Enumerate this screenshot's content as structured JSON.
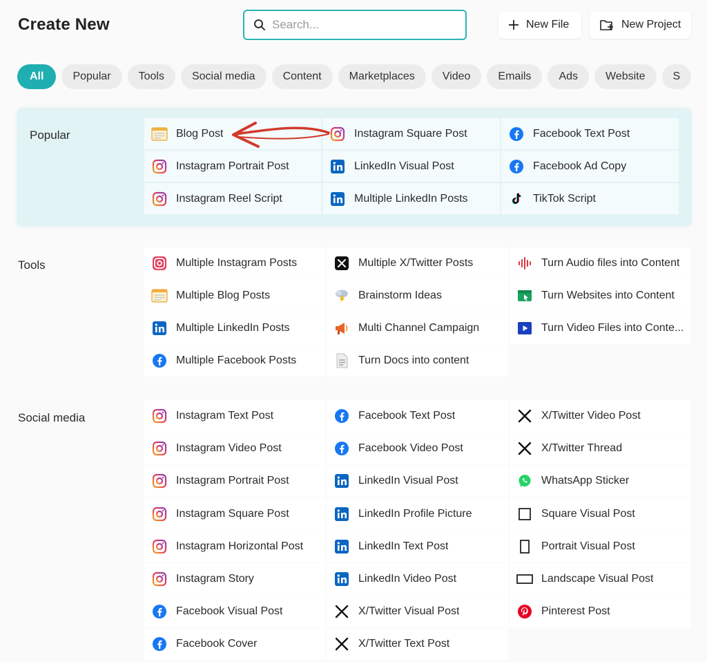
{
  "header": {
    "title": "Create New",
    "search_placeholder": "Search...",
    "new_file_label": "New File",
    "new_project_label": "New Project"
  },
  "filters": [
    "All",
    "Popular",
    "Tools",
    "Social media",
    "Content",
    "Marketplaces",
    "Video",
    "Emails",
    "Ads",
    "Website",
    "S"
  ],
  "sections": {
    "popular": {
      "label": "Popular",
      "items": [
        {
          "label": "Blog Post",
          "icon": "blog-icon"
        },
        {
          "label": "Instagram Square Post",
          "icon": "instagram-icon"
        },
        {
          "label": "Facebook Text Post",
          "icon": "facebook-icon"
        },
        {
          "label": "Instagram Portrait Post",
          "icon": "instagram-icon"
        },
        {
          "label": "LinkedIn Visual Post",
          "icon": "linkedin-icon"
        },
        {
          "label": "Facebook Ad Copy",
          "icon": "facebook-icon"
        },
        {
          "label": "Instagram Reel Script",
          "icon": "instagram-icon"
        },
        {
          "label": "Multiple LinkedIn Posts",
          "icon": "linkedin-icon"
        },
        {
          "label": "TikTok Script",
          "icon": "tiktok-icon"
        }
      ]
    },
    "tools": {
      "label": "Tools",
      "items": [
        {
          "label": "Multiple Instagram Posts",
          "icon": "instagram-multi-icon"
        },
        {
          "label": "Multiple X/Twitter Posts",
          "icon": "x-twitter-multi-icon"
        },
        {
          "label": "Turn Audio files into Content",
          "icon": "audio-wave-icon"
        },
        {
          "label": "Multiple Blog Posts",
          "icon": "blog-icon"
        },
        {
          "label": "Brainstorm Ideas",
          "icon": "brainstorm-icon"
        },
        {
          "label": "Turn Websites into Content",
          "icon": "website-icon"
        },
        {
          "label": "Multiple LinkedIn Posts",
          "icon": "linkedin-icon"
        },
        {
          "label": "Multi Channel Campaign",
          "icon": "megaphone-icon"
        },
        {
          "label": "Turn Video Files into Conte...",
          "icon": "video-play-icon"
        },
        {
          "label": "Multiple Facebook Posts",
          "icon": "facebook-icon"
        },
        {
          "label": "Turn Docs into content",
          "icon": "document-icon"
        }
      ]
    },
    "social": {
      "label": "Social media",
      "items": [
        {
          "label": "Instagram Text Post",
          "icon": "instagram-icon"
        },
        {
          "label": "Facebook Text Post",
          "icon": "facebook-icon"
        },
        {
          "label": "X/Twitter Video Post",
          "icon": "x-twitter-icon"
        },
        {
          "label": "Instagram Video Post",
          "icon": "instagram-icon"
        },
        {
          "label": "Facebook Video Post",
          "icon": "facebook-icon"
        },
        {
          "label": "X/Twitter Thread",
          "icon": "x-twitter-icon"
        },
        {
          "label": "Instagram Portrait Post",
          "icon": "instagram-icon"
        },
        {
          "label": "LinkedIn Visual Post",
          "icon": "linkedin-icon"
        },
        {
          "label": "WhatsApp Sticker",
          "icon": "whatsapp-icon"
        },
        {
          "label": "Instagram Square Post",
          "icon": "instagram-icon"
        },
        {
          "label": "LinkedIn Profile Picture",
          "icon": "linkedin-icon"
        },
        {
          "label": "Square Visual Post",
          "icon": "square-frame-icon"
        },
        {
          "label": "Instagram Horizontal Post",
          "icon": "instagram-icon"
        },
        {
          "label": "LinkedIn Text Post",
          "icon": "linkedin-icon"
        },
        {
          "label": "Portrait Visual Post",
          "icon": "portrait-frame-icon"
        },
        {
          "label": "Instagram Story",
          "icon": "instagram-icon"
        },
        {
          "label": "LinkedIn Video Post",
          "icon": "linkedin-icon"
        },
        {
          "label": "Landscape Visual Post",
          "icon": "landscape-frame-icon"
        },
        {
          "label": "Facebook Visual Post",
          "icon": "facebook-icon"
        },
        {
          "label": "X/Twitter Visual Post",
          "icon": "x-twitter-icon"
        },
        {
          "label": "Pinterest Post",
          "icon": "pinterest-icon"
        },
        {
          "label": "Facebook Cover",
          "icon": "facebook-icon"
        },
        {
          "label": "X/Twitter Text Post",
          "icon": "x-twitter-icon"
        }
      ]
    }
  },
  "colors": {
    "accent": "#1faeb2",
    "annotation_arrow": "#d23a2a",
    "popular_panel_bg": "#e2f3f5"
  }
}
